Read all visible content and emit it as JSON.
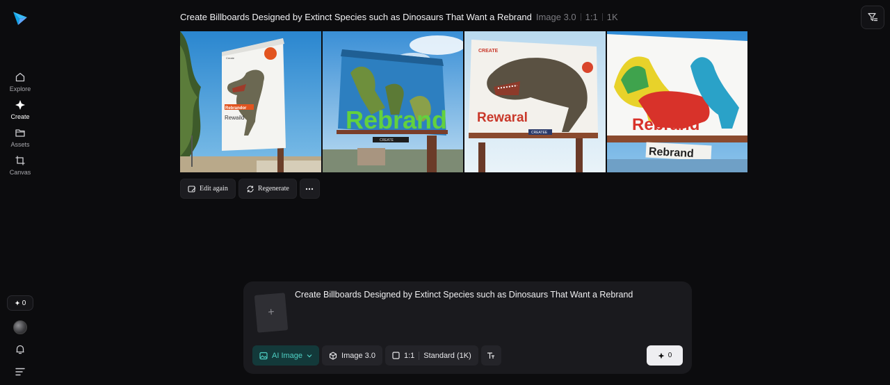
{
  "sidebar": {
    "logo": "paper-plane-logo",
    "items": [
      {
        "label": "Explore",
        "icon": "home-icon"
      },
      {
        "label": "Create",
        "icon": "sparkle-icon",
        "active": true
      },
      {
        "label": "Assets",
        "icon": "folder-icon"
      },
      {
        "label": "Canvas",
        "icon": "crop-icon"
      }
    ],
    "credits": "0",
    "credits_icon": "sparkle-icon"
  },
  "header": {
    "prompt": "Create Billboards Designed by Extinct Species such as Dinosaurs That Want a Rebrand",
    "model": "Image 3.0",
    "ratio": "1:1",
    "resolution": "1K"
  },
  "images": [
    {
      "billboard_brand": "Create",
      "headline": "Rebrandor",
      "subline": "Rewaild"
    },
    {
      "headline": "Rebrand",
      "sign": "CREATE"
    },
    {
      "brand": "CREATE",
      "headline": "Rewaral",
      "sign": "CREATEE"
    },
    {
      "headline": "Rebrand",
      "sign": "Rebrand"
    }
  ],
  "actions": {
    "edit_again": "Edit again",
    "regenerate": "Regenerate",
    "more_icon": "ellipsis-icon"
  },
  "composer": {
    "prompt": "Create Billboards Designed by Extinct Species such as Dinosaurs That Want a Rebrand",
    "add_reference": "+",
    "mode": "AI Image",
    "model": "Image 3.0",
    "ratio": "1:1",
    "quality": "Standard (1K)",
    "generate_cost": "0"
  },
  "colors": {
    "accent": "#4fd1c5",
    "background": "#0c0c0e",
    "panel": "#1a1a1e"
  }
}
